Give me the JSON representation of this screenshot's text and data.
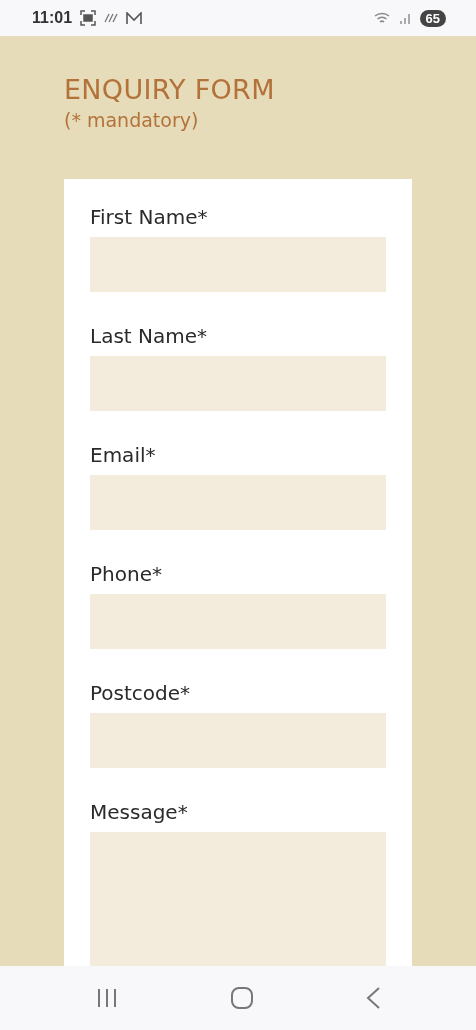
{
  "status_bar": {
    "time": "11:01",
    "battery": "65"
  },
  "form": {
    "title": "ENQUIRY FORM",
    "note": "(* mandatory)",
    "fields": [
      {
        "label": "First Name*",
        "kind": "input"
      },
      {
        "label": "Last Name*",
        "kind": "input"
      },
      {
        "label": "Email*",
        "kind": "input"
      },
      {
        "label": "Phone*",
        "kind": "input"
      },
      {
        "label": "Postcode*",
        "kind": "input"
      },
      {
        "label": "Message*",
        "kind": "textarea"
      }
    ]
  }
}
